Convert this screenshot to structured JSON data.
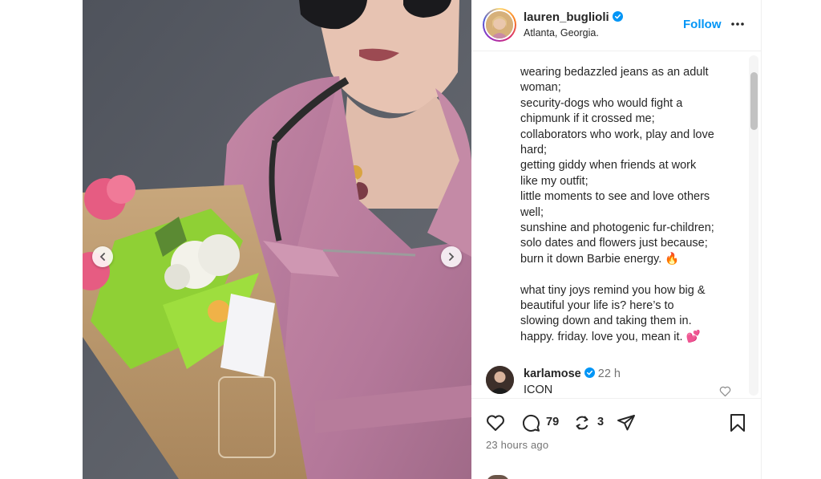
{
  "post": {
    "username": "lauren_buglioli",
    "location": "Atlanta, Georgia.",
    "follow_label": "Follow",
    "verified": true,
    "icons": {
      "verified": "verified-badge-icon",
      "more": "more-options-icon"
    },
    "caption_lines": [
      "wearing bedazzled jeans as an adult",
      "woman;",
      "security-dogs who would fight a",
      "chipmunk if it crossed me;",
      "collaborators who work, play and love",
      "hard;",
      "getting giddy when friends at work",
      "like my outfit;",
      "little moments to see and love others",
      "well;",
      "sunshine and photogenic fur-children;",
      "solo dates and flowers just because;",
      "burn it down Barbie energy. 🔥",
      "",
      "what tiny joys remind you how big &",
      "beautiful your life is?  here’s to",
      "slowing down and taking them in.",
      "happy. friday. love you, mean it. 💕"
    ]
  },
  "comment": {
    "username": "karlamose",
    "time": "22 h",
    "text": "ICON",
    "verified": true
  },
  "actions": {
    "comment_count": "79",
    "repost_count": "3",
    "time_ago": "23 hours ago",
    "icons": [
      "heart-icon",
      "comment-icon",
      "repost-icon",
      "share-icon",
      "bookmark-icon"
    ]
  },
  "colors": {
    "accent": "#0095f6",
    "text": "#262626",
    "muted": "#737373",
    "verified": "#0095f6"
  }
}
